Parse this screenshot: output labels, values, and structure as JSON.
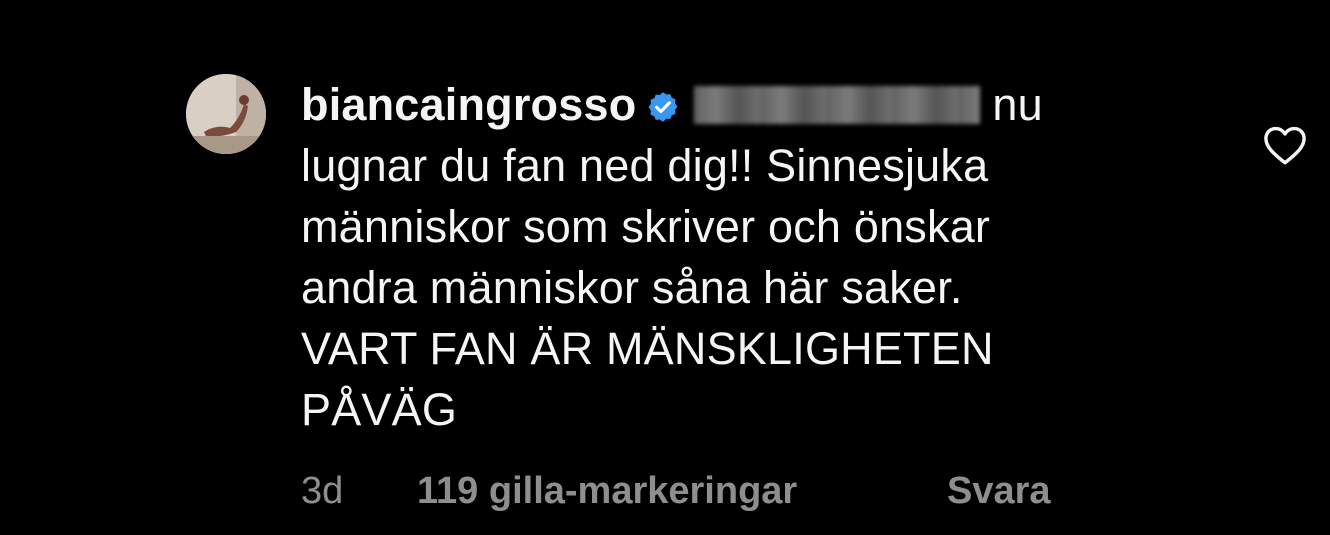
{
  "comment": {
    "username": "biancaingrosso",
    "verified": true,
    "mention_blurred": true,
    "text_lines": [
      "nu",
      "lugnar du fan ned dig!! Sinnesjuka",
      "människor som skriver och önskar",
      "andra människor såna här saker.",
      "VART FAN ÄR MÄNSKLIGHETEN",
      "PÅVÄG"
    ],
    "time": "3d",
    "likes": "119 gilla-markeringar",
    "reply_label": "Svara",
    "like_icon": "heart-outline-icon",
    "verified_icon": "verified-badge-icon"
  },
  "colors": {
    "background": "#000000",
    "text": "#f5f5f5",
    "meta": "#8e8e8e",
    "verified": "#3897f0"
  }
}
